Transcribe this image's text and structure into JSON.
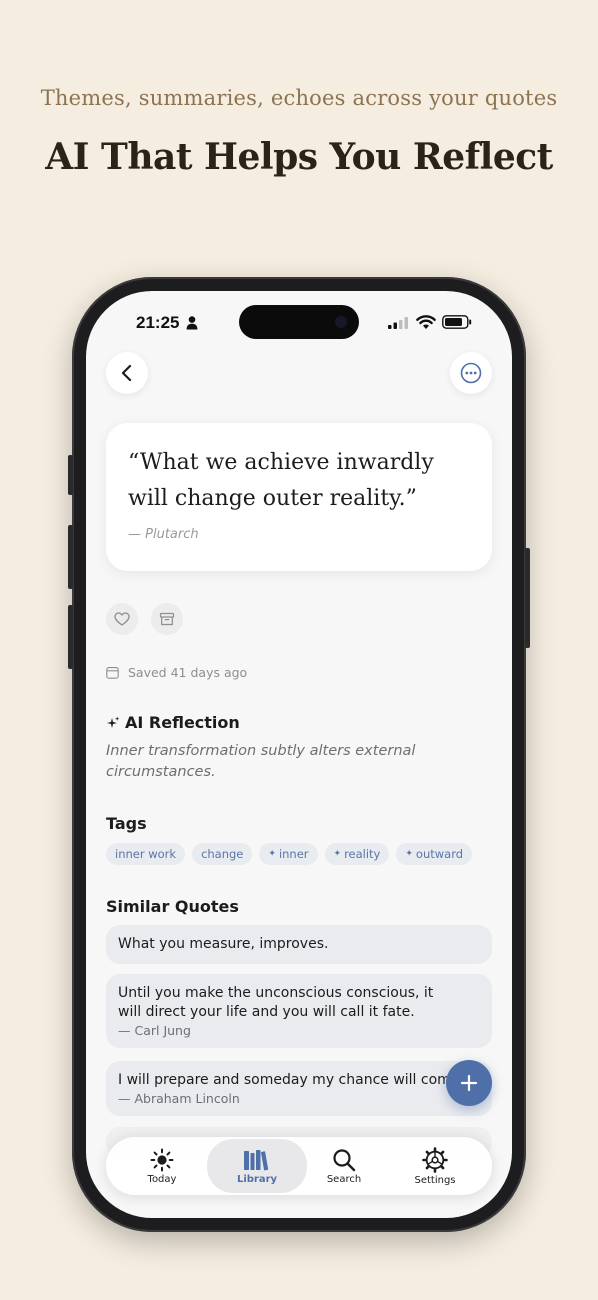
{
  "header": {
    "subtitle": "Themes, summaries, echoes across your quotes",
    "title": "AI That Helps You Reflect"
  },
  "status_bar": {
    "time": "21:25"
  },
  "quote": {
    "text": "“What we achieve inwardly will change outer reality.”",
    "author": "— Plutarch"
  },
  "meta": {
    "saved": "Saved 41 days ago"
  },
  "ai_reflection": {
    "title": "AI Reflection",
    "text": "Inner transformation subtly alters external circumstances."
  },
  "tags": {
    "title": "Tags",
    "items": [
      {
        "label": "inner work",
        "ai": false
      },
      {
        "label": "change",
        "ai": false
      },
      {
        "label": "inner",
        "ai": true
      },
      {
        "label": "reality",
        "ai": true
      },
      {
        "label": "outward",
        "ai": true
      }
    ]
  },
  "similar": {
    "title": "Similar Quotes",
    "items": [
      {
        "text": "What you measure, improves.",
        "author": ""
      },
      {
        "text": "Until you make the unconscious conscious, it will direct your life and you will call it fate.",
        "author": "— Carl Jung"
      },
      {
        "text": "I will prepare and someday my chance will come.",
        "author": "— Abraham Lincoln"
      }
    ]
  },
  "tabbar": {
    "today": "Today",
    "library": "Library",
    "search": "Search",
    "settings": "Settings"
  },
  "colors": {
    "accent": "#4f6fa8",
    "background": "#f5ede0",
    "subtitle": "#8c7351"
  }
}
